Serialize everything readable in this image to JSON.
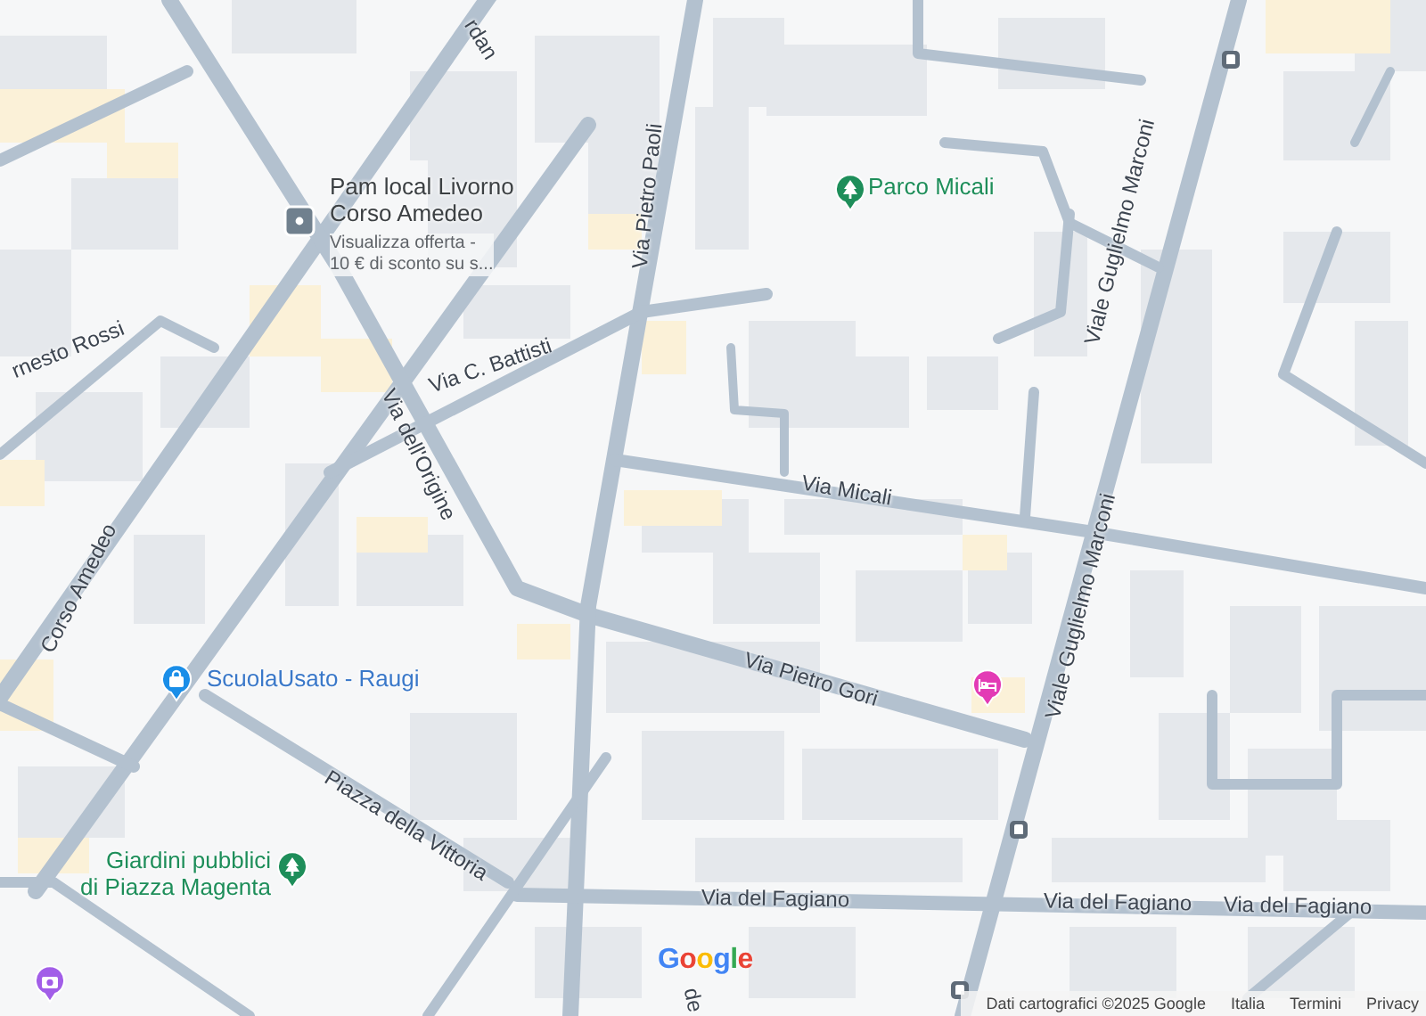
{
  "map": {
    "streets": [
      {
        "kind": "street",
        "text": "rdan"
      },
      {
        "kind": "street",
        "text": "rnesto Rossi"
      },
      {
        "kind": "street",
        "text": "Via C. Battisti"
      },
      {
        "kind": "street",
        "text": "Via Pietro Paoli"
      },
      {
        "kind": "street",
        "text": "Via dell'Origine"
      },
      {
        "kind": "street",
        "text": "Corso Amedeo"
      },
      {
        "kind": "street",
        "text": "Via Micali"
      },
      {
        "kind": "street",
        "text": "Viale Guglielmo Marconi"
      },
      {
        "kind": "street",
        "text": "Viale Guglielmo Marconi"
      },
      {
        "kind": "street",
        "text": "Via Pietro Gori"
      },
      {
        "kind": "street",
        "text": "Piazza della Vittoria"
      },
      {
        "kind": "street",
        "text": "Via del Fagiano"
      },
      {
        "kind": "street",
        "text": "Via del Fagiano"
      },
      {
        "kind": "street",
        "text": "Via del Fagiano"
      },
      {
        "kind": "street",
        "text": "de"
      }
    ],
    "places": [
      {
        "kind": "shop",
        "name": "Pam local Livorno\nCorso Amedeo",
        "note": "Visualizza offerta -\n10 € di sconto su s...",
        "color": "#70808e"
      },
      {
        "kind": "park",
        "name": "Parco Micali",
        "color": "#1e8e5a"
      },
      {
        "kind": "store",
        "name": "ScuolaUsato - Raugi",
        "color": "#1a8ee8"
      },
      {
        "kind": "park",
        "name": "Giardini pubblici\ndi Piazza Magenta",
        "color": "#1e8e5a"
      },
      {
        "kind": "hotel",
        "color": "#e33bb5"
      },
      {
        "kind": "camera",
        "color": "#a25ee8"
      }
    ],
    "logo": "Google",
    "attribution": [
      "Dati cartografici ©2025 Google",
      "Italia",
      "Termini",
      "Privacy"
    ]
  }
}
